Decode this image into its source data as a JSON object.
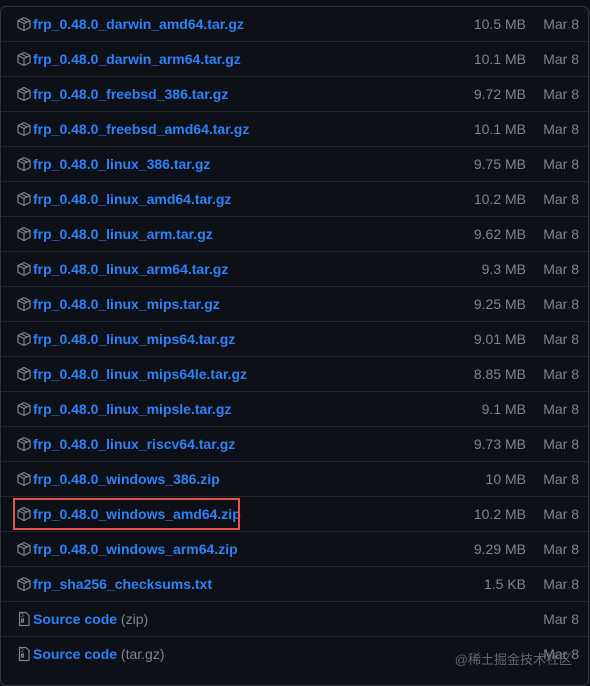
{
  "assets": [
    {
      "name": "frp_0.48.0_darwin_amd64.tar.gz",
      "size": "10.5 MB",
      "date": "Mar 8",
      "icon": "package-icon"
    },
    {
      "name": "frp_0.48.0_darwin_arm64.tar.gz",
      "size": "10.1 MB",
      "date": "Mar 8",
      "icon": "package-icon"
    },
    {
      "name": "frp_0.48.0_freebsd_386.tar.gz",
      "size": "9.72 MB",
      "date": "Mar 8",
      "icon": "package-icon"
    },
    {
      "name": "frp_0.48.0_freebsd_amd64.tar.gz",
      "size": "10.1 MB",
      "date": "Mar 8",
      "icon": "package-icon"
    },
    {
      "name": "frp_0.48.0_linux_386.tar.gz",
      "size": "9.75 MB",
      "date": "Mar 8",
      "icon": "package-icon"
    },
    {
      "name": "frp_0.48.0_linux_amd64.tar.gz",
      "size": "10.2 MB",
      "date": "Mar 8",
      "icon": "package-icon"
    },
    {
      "name": "frp_0.48.0_linux_arm.tar.gz",
      "size": "9.62 MB",
      "date": "Mar 8",
      "icon": "package-icon"
    },
    {
      "name": "frp_0.48.0_linux_arm64.tar.gz",
      "size": "9.3 MB",
      "date": "Mar 8",
      "icon": "package-icon"
    },
    {
      "name": "frp_0.48.0_linux_mips.tar.gz",
      "size": "9.25 MB",
      "date": "Mar 8",
      "icon": "package-icon"
    },
    {
      "name": "frp_0.48.0_linux_mips64.tar.gz",
      "size": "9.01 MB",
      "date": "Mar 8",
      "icon": "package-icon"
    },
    {
      "name": "frp_0.48.0_linux_mips64le.tar.gz",
      "size": "8.85 MB",
      "date": "Mar 8",
      "icon": "package-icon"
    },
    {
      "name": "frp_0.48.0_linux_mipsle.tar.gz",
      "size": "9.1 MB",
      "date": "Mar 8",
      "icon": "package-icon"
    },
    {
      "name": "frp_0.48.0_linux_riscv64.tar.gz",
      "size": "9.73 MB",
      "date": "Mar 8",
      "icon": "package-icon"
    },
    {
      "name": "frp_0.48.0_windows_386.zip",
      "size": "10 MB",
      "date": "Mar 8",
      "icon": "package-icon"
    },
    {
      "name": "frp_0.48.0_windows_amd64.zip",
      "size": "10.2 MB",
      "date": "Mar 8",
      "icon": "package-icon",
      "highlighted": true
    },
    {
      "name": "frp_0.48.0_windows_arm64.zip",
      "size": "9.29 MB",
      "date": "Mar 8",
      "icon": "package-icon"
    },
    {
      "name": "frp_sha256_checksums.txt",
      "size": "1.5 KB",
      "date": "Mar 8",
      "icon": "package-icon"
    },
    {
      "name": "Source code",
      "suffix": "(zip)",
      "size": "",
      "date": "Mar 8",
      "icon": "file-zip-icon"
    },
    {
      "name": "Source code",
      "suffix": "(tar.gz)",
      "size": "",
      "date": "Mar 8",
      "icon": "file-zip-icon"
    }
  ],
  "watermark": "@稀土掘金技术社区",
  "colors": {
    "background": "#0d1117",
    "link": "#2f81f7",
    "muted": "#7d8590",
    "border": "#30363d",
    "highlight": "#e5534b"
  }
}
